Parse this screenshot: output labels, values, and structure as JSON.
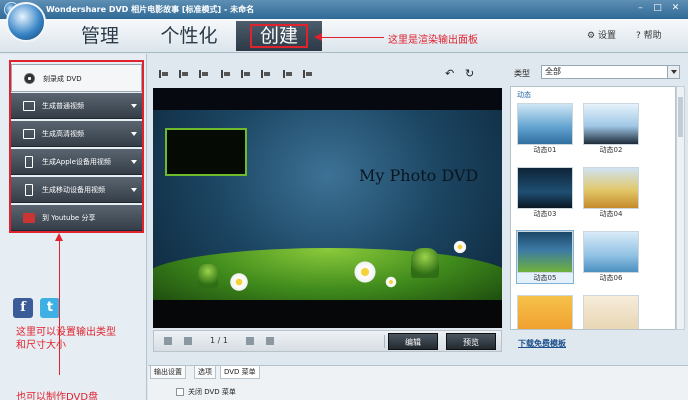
{
  "window": {
    "title": "Wondershare DVD 相片电影故事 [标准模式] - 未命名",
    "min": "–",
    "max": "□",
    "close": "✕"
  },
  "tabs": [
    "管理",
    "个性化",
    "创建"
  ],
  "header_links": {
    "settings": "设置",
    "help": "帮助"
  },
  "annotations": {
    "render_panel": "这里是渲染输出面板",
    "output_type": "这里可以设置输出类型\n和尺寸大小",
    "make_dvd": "也可以制作DVD盘"
  },
  "output_options": [
    "刻录成 DVD",
    "生成普通视频",
    "生成高清视频",
    "生成Apple设备用视频",
    "生成移动设备用视频",
    "到 Youtube 分享"
  ],
  "social": {
    "facebook": "f",
    "twitter": "t"
  },
  "preview": {
    "title": "My Photo DVD"
  },
  "playback": {
    "page": "1 / 1",
    "edit": "编辑",
    "preview": "预览"
  },
  "bottom_tabs": [
    "输出设置",
    "选项",
    "DVD 菜单"
  ],
  "bottom": {
    "close_menu": "关闭 DVD 菜单"
  },
  "templates": {
    "type_label": "类型",
    "type_value": "全部",
    "category": "动态",
    "items": [
      "动态01",
      "动态02",
      "动态03",
      "动态04",
      "动态05",
      "动态06"
    ],
    "download_link": "下载免费模板"
  }
}
